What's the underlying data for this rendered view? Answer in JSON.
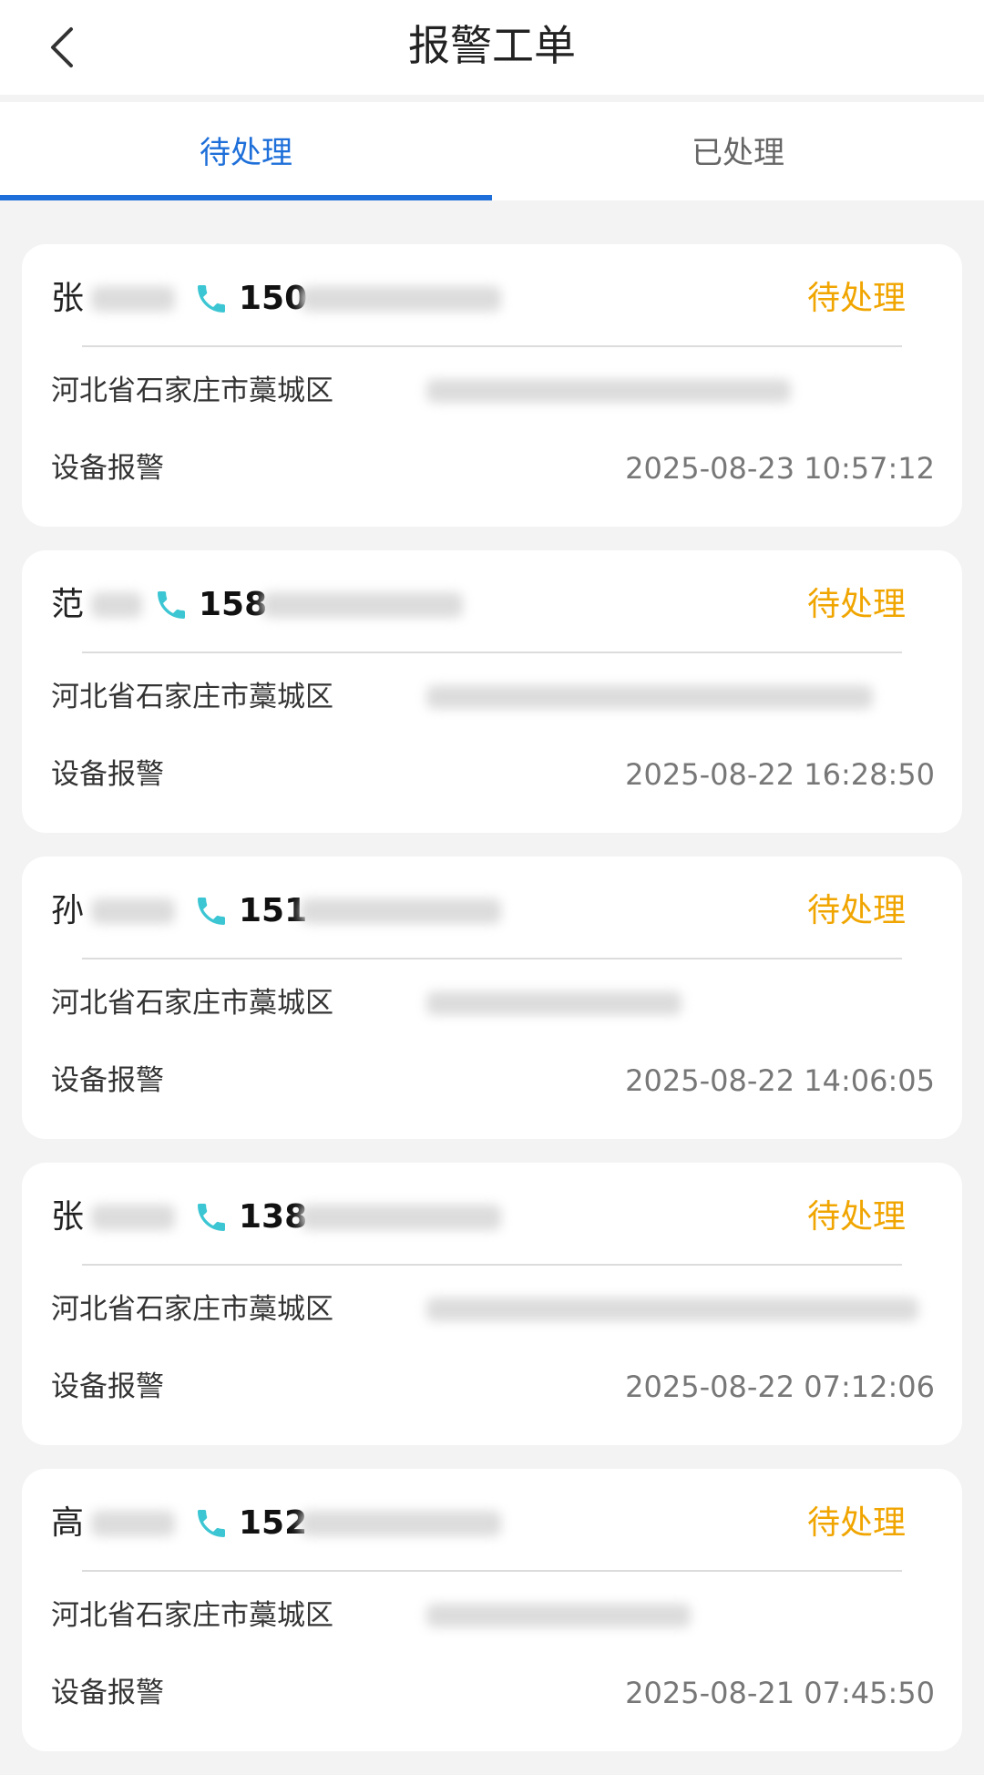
{
  "header": {
    "title": "报警工单",
    "back_icon": "chevron-left-icon"
  },
  "tabs": [
    {
      "label": "待处理",
      "active": true
    },
    {
      "label": "已处理",
      "active": false
    }
  ],
  "colors": {
    "accent": "#1e6fd9",
    "status_pending": "#f0a500",
    "phone_icon": "#3cc6d3"
  },
  "cards": [
    {
      "surname": "张",
      "phone_prefix": "150",
      "status": "待处理",
      "address_prefix": "河北省石家庄市藁城区",
      "type": "设备报警",
      "time": "2025-08-23 10:57:12"
    },
    {
      "surname": "范",
      "phone_prefix": "158",
      "status": "待处理",
      "address_prefix": "河北省石家庄市藁城区",
      "type": "设备报警",
      "time": "2025-08-22 16:28:50"
    },
    {
      "surname": "孙",
      "phone_prefix": "151",
      "status": "待处理",
      "address_prefix": "河北省石家庄市藁城区",
      "type": "设备报警",
      "time": "2025-08-22 14:06:05"
    },
    {
      "surname": "张",
      "phone_prefix": "138",
      "status": "待处理",
      "address_prefix": "河北省石家庄市藁城区",
      "type": "设备报警",
      "time": "2025-08-22 07:12:06"
    },
    {
      "surname": "高",
      "phone_prefix": "152",
      "status": "待处理",
      "address_prefix": "河北省石家庄市藁城区",
      "type": "设备报警",
      "time": "2025-08-21 07:45:50"
    }
  ]
}
